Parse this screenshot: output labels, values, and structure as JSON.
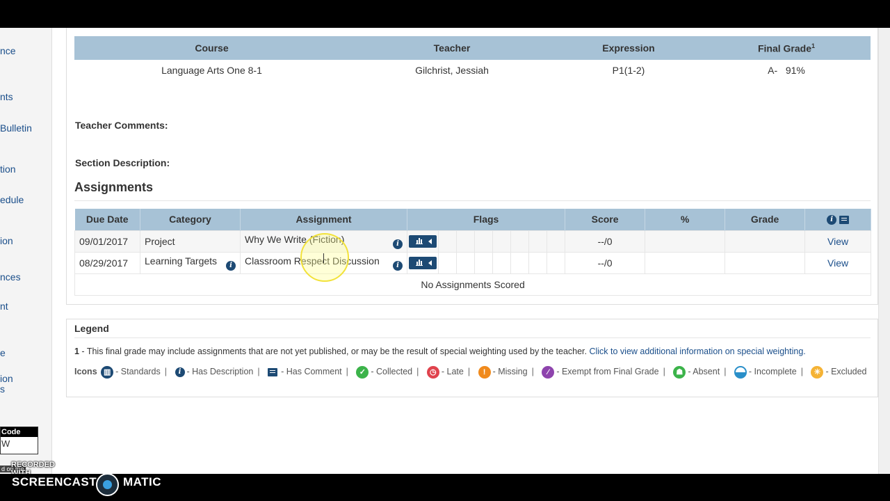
{
  "sidebar": {
    "items": [
      {
        "label": "nce"
      },
      {
        "label": "nts"
      },
      {
        "label": "Bulletin"
      },
      {
        "label": "tion"
      },
      {
        "label": "edule"
      },
      {
        "label": "ion"
      },
      {
        "label": "nces"
      },
      {
        "label": "nt"
      },
      {
        "label": "e"
      },
      {
        "label": "ion"
      },
      {
        "label": "s"
      }
    ],
    "code_label": "Code",
    "code_value": "W"
  },
  "course_table": {
    "headers": [
      "Course",
      "Teacher",
      "Expression",
      "Final Grade"
    ],
    "final_grade_sup": "1",
    "row": {
      "course": "Language Arts One 8-1",
      "teacher": "Gilchrist, Jessiah",
      "expression": "P1(1-2)",
      "final_grade": "A-",
      "percent": "91%"
    }
  },
  "teacher_comments_label": "Teacher Comments:",
  "section_description_label": "Section Description:",
  "assignments": {
    "title": "Assignments",
    "headers": [
      "Due Date",
      "Category",
      "Assignment",
      "Flags",
      "Score",
      "%",
      "Grade"
    ],
    "rows": [
      {
        "due": "09/01/2017",
        "category": "Project",
        "assignment": "Why We Write (Fiction)",
        "score": "--/0",
        "percent": "",
        "grade": "",
        "action": "View"
      },
      {
        "due": "08/29/2017",
        "category": "Learning Targets",
        "assignment": "Classroom Respect Discussion",
        "score": "--/0",
        "percent": "",
        "grade": "",
        "action": "View"
      }
    ],
    "empty_message": "No Assignments Scored"
  },
  "legend": {
    "title": "Legend",
    "note_number": "1",
    "note_text": " - This final grade may include assignments that are not yet published, or may be the result of special weighting used by the teacher. ",
    "note_link": "Click to view additional information on special weighting.",
    "icons_label": "Icons",
    "items": [
      {
        "icon": "standards-icon",
        "label": "- Standards",
        "color": "#1d4a74"
      },
      {
        "icon": "has-description-icon",
        "label": "- Has Description",
        "color": "#1d4a74"
      },
      {
        "icon": "has-comment-icon",
        "label": "- Has Comment",
        "color": "#1d4a74"
      },
      {
        "icon": "collected-icon",
        "label": "- Collected",
        "color": "#3cb34a"
      },
      {
        "icon": "late-icon",
        "label": "- Late",
        "color": "#e0434d"
      },
      {
        "icon": "missing-icon",
        "label": "- Missing",
        "color": "#f08a1c"
      },
      {
        "icon": "exempt-icon",
        "label": "- Exempt from Final Grade",
        "color": "#8e44ad"
      },
      {
        "icon": "absent-icon",
        "label": "- Absent",
        "color": "#3cb34a"
      },
      {
        "icon": "incomplete-icon",
        "label": "- Incomplete",
        "color": "#2a8fc9"
      },
      {
        "icon": "excluded-icon",
        "label": "- Excluded",
        "color": "#f5b335"
      }
    ]
  },
  "overlay": {
    "recorded_with": "RECORDED WITH",
    "brand_left": "SCREENCAST",
    "brand_right": "MATIC",
    "tiny_note": "d on the"
  }
}
